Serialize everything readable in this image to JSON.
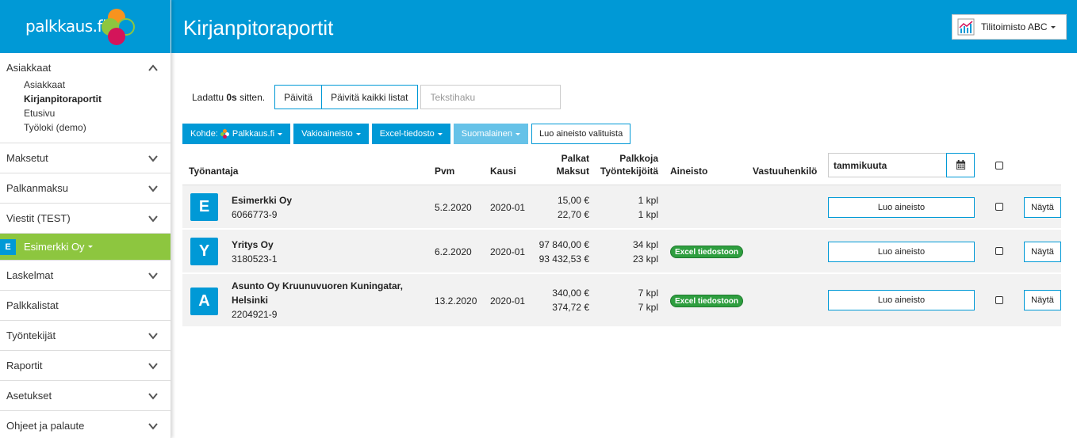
{
  "sidebar": {
    "logo_text": "palkkaus.fi",
    "sections": [
      {
        "label": "Asiakkaat",
        "expanded": true,
        "items": [
          "Asiakkaat",
          "Kirjanpitoraportit",
          "Etusivu",
          "Työloki (demo)"
        ],
        "active_item": "Kirjanpitoraportit"
      },
      {
        "label": "Maksetut"
      },
      {
        "label": "Palkanmaksu"
      },
      {
        "label": "Viestit (TEST)"
      }
    ],
    "active_company": {
      "badge": "E",
      "label": "Esimerkki Oy"
    },
    "sections_after": [
      {
        "label": "Laskelmat",
        "chevron": true
      },
      {
        "label": "Palkkalistat",
        "chevron": false
      },
      {
        "label": "Työntekijät",
        "chevron": true
      },
      {
        "label": "Raportit",
        "chevron": true
      },
      {
        "label": "Asetukset",
        "chevron": true
      },
      {
        "label": "Ohjeet ja palaute",
        "chevron": true
      }
    ]
  },
  "header": {
    "title": "Kirjanpitoraportit",
    "org_button": "Tilitoimisto ABC"
  },
  "toolbar": {
    "loaded_prefix": "Ladattu ",
    "loaded_value": "0s",
    "loaded_suffix": " sitten.",
    "refresh": "Päivitä",
    "refresh_all": "Päivitä kaikki listat",
    "search_placeholder": "Tekstihaku"
  },
  "filters": {
    "target_prefix": "Kohde:",
    "target_value": "Palkkaus.fi",
    "standard": "Vakioaineisto",
    "excel": "Excel-tiedosto",
    "language": "Suomalainen",
    "create_selected": "Luo aineisto valituista"
  },
  "table": {
    "headers": {
      "employer": "Työnantaja",
      "date": "Pvm",
      "period": "Kausi",
      "salaries": "Palkat",
      "payments": "Maksut",
      "salaries_count": "Palkkoja",
      "employees": "Työntekijöitä",
      "material": "Aineisto",
      "responsible": "Vastuuhenkilö",
      "month_value": "tammikuuta"
    },
    "rows": [
      {
        "avatar": "E",
        "name": "Esimerkki Oy",
        "name2": "",
        "id": "6066773-9",
        "date": "5.2.2020",
        "period": "2020-01",
        "salaries": "15,00 €",
        "payments": "22,70 €",
        "count1": "1 kpl",
        "count2": "1 kpl",
        "material": "",
        "create": "Luo aineisto",
        "show": "Näytä"
      },
      {
        "avatar": "Y",
        "name": "Yritys Oy",
        "name2": "",
        "id": "3180523-1",
        "date": "6.2.2020",
        "period": "2020-01",
        "salaries": "97 840,00 €",
        "payments": "93 432,53 €",
        "count1": "34 kpl",
        "count2": "23 kpl",
        "material": "Excel tiedostoon",
        "create": "Luo aineisto",
        "show": "Näytä"
      },
      {
        "avatar": "A",
        "name": "Asunto Oy Kruunuvuoren Kuningatar,",
        "name2": "Helsinki",
        "id": "2204921-9",
        "date": "13.2.2020",
        "period": "2020-01",
        "salaries": "340,00 €",
        "payments": "374,72 €",
        "count1": "7 kpl",
        "count2": "7 kpl",
        "material": "Excel tiedostoon",
        "create": "Luo aineisto",
        "show": "Näytä"
      }
    ]
  },
  "colors": {
    "primary": "#0099d6",
    "active_green": "#8dc63f",
    "pill_green": "#2e9e3f"
  }
}
